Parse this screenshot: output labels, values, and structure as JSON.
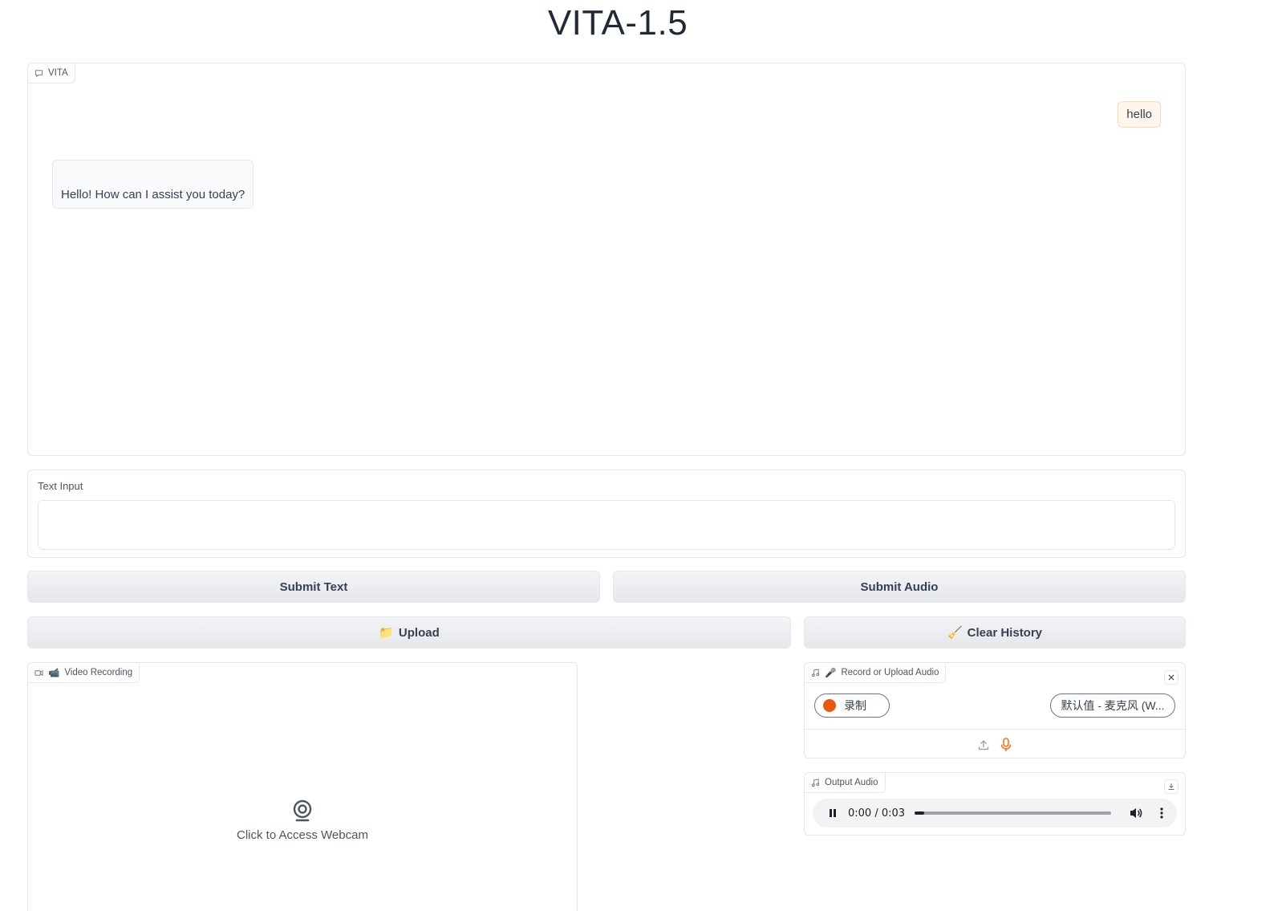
{
  "app_title": "VITA-1.5",
  "chatbot": {
    "label": "VITA",
    "messages": [
      {
        "role": "user",
        "text": "hello"
      },
      {
        "role": "assistant",
        "text": "Hello! How can I assist you today?"
      }
    ]
  },
  "text_input": {
    "label": "Text Input",
    "value": ""
  },
  "buttons": {
    "submit_text": "Submit Text",
    "submit_audio": "Submit Audio",
    "upload": "Upload",
    "upload_icon": "📁",
    "clear_history": "Clear History",
    "clear_icon": "🧹"
  },
  "video": {
    "label": "Video Recording",
    "label_icon": "📹",
    "prompt": "Click to Access Webcam"
  },
  "audio_input": {
    "label": "Record or Upload Audio",
    "label_icon": "🎤",
    "record_label": "录制",
    "device_label": "默认值 - 麦克风 (W..."
  },
  "output_audio": {
    "label": "Output Audio",
    "time": "0:00 / 0:03",
    "progress": 0.05
  },
  "colors": {
    "accent": "#f97316",
    "record_dot": "#ea580c"
  }
}
